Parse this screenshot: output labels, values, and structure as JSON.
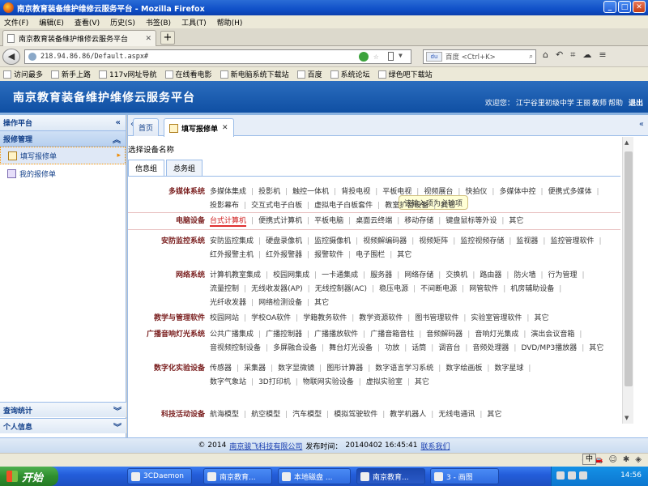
{
  "window": {
    "title": "南京教育装备维护维修云服务平台 - Mozilla Firefox"
  },
  "menu": [
    "文件(F)",
    "编辑(E)",
    "查看(V)",
    "历史(S)",
    "书签(B)",
    "工具(T)",
    "帮助(H)"
  ],
  "browser_tab": {
    "title": "南京教育装备维护维修云服务平台",
    "new_tab": "+"
  },
  "address": {
    "url": "218.94.86.86/Default.aspx#"
  },
  "search": {
    "engine": "百度",
    "placeholder": "百度 <Ctrl+K>"
  },
  "bookmarks": [
    "访问最多",
    "新手上路",
    "117v网址导航",
    "在线看电影",
    "新电脑系统下载站",
    "百度",
    "系统论坛",
    "绿色吧下载站"
  ],
  "app": {
    "title": "南京教育装备维护维修云服务平台",
    "welcome": "欢迎您：",
    "school": "江宁谷里初级中学",
    "user": "王丽",
    "role": "教师",
    "help": "帮助",
    "logout": "退出"
  },
  "sidebar": {
    "header": "操作平台",
    "section": "报修管理",
    "items": [
      {
        "label": "填写报修单"
      },
      {
        "label": "我的报修单"
      }
    ],
    "bottom": [
      "查询统计",
      "个人信息"
    ]
  },
  "main_tabs": [
    {
      "label": "首页"
    },
    {
      "label": "填写报修单"
    }
  ],
  "panel": {
    "title": "选择设备名称",
    "sub_tabs": [
      "信息组",
      "总务组"
    ],
    "tooltip": "该输入项为必输项",
    "selected_item": "台式计算机"
  },
  "categories": [
    {
      "name": "多媒体系统",
      "items": [
        "多媒体集成",
        "投影机",
        "触控一体机",
        "背投电视",
        "平板电视",
        "视频展台",
        "快拍仪",
        "多媒体中控",
        "便携式多媒体",
        "投影幕布",
        "交互式电子白板",
        "虚拟电子白板套件",
        "教室扩音设备",
        "其它"
      ]
    },
    {
      "name": "电脑设备",
      "items": [
        "台式计算机",
        "便携式计算机",
        "平板电脑",
        "桌面云终端",
        "移动存储",
        "键盘鼠标等外设",
        "其它"
      ]
    },
    {
      "name": "安防监控系统",
      "items": [
        "安防监控集成",
        "硬盘录像机",
        "监控摄像机",
        "视频解编码器",
        "视频矩阵",
        "监控视频存储",
        "监视器",
        "监控管理软件",
        "红外报警主机",
        "红外报警器",
        "报警软件",
        "电子围栏",
        "其它"
      ]
    },
    {
      "name": "网络系统",
      "items": [
        "计算机教室集成",
        "校园网集成",
        "一卡通集成",
        "服务器",
        "网络存储",
        "交换机",
        "路由器",
        "防火墙",
        "行为管理",
        "流量控制",
        "无线收发器(AP)",
        "无线控制器(AC)",
        "稳压电源",
        "不间断电源",
        "网管软件",
        "机房辅助设备",
        "光纤收发器",
        "网络检测设备",
        "其它"
      ]
    },
    {
      "name": "教学与管理软件",
      "items": [
        "校园网站",
        "学校OA软件",
        "学籍教务软件",
        "教学资源软件",
        "图书管理软件",
        "实验室管理软件",
        "其它"
      ]
    },
    {
      "name": "广播音响灯光系统",
      "items": [
        "公共广播集成",
        "广播控制器",
        "广播播放软件",
        "广播音箱音柱",
        "音频解码器",
        "音响灯光集成",
        "演出会议音箱",
        "音视频控制设备",
        "多屏融合设备",
        "舞台灯光设备",
        "功放",
        "话筒",
        "调音台",
        "音频处理器",
        "DVD/MP3播放器",
        "其它"
      ]
    },
    {
      "name": "数字化实验设备",
      "items": [
        "传感器",
        "采集器",
        "数字显微镜",
        "图形计算器",
        "数字语言学习系统",
        "数字绘画板",
        "数字星球",
        "数字气象站",
        "3D打印机",
        "物联网实验设备",
        "虚拟实验室",
        "其它"
      ]
    },
    {
      "name": "科技活动设备",
      "items": [
        "航海模型",
        "航空模型",
        "汽车模型",
        "模拟驾驶软件",
        "教学机器人",
        "无线电通讯",
        "其它"
      ]
    }
  ],
  "footer": {
    "copyright": "© 2014",
    "company": "南京骏飞科技有限公司",
    "publish_label": "发布时间：",
    "publish_time": "20140402 16:45:41",
    "contact": "联系我们"
  },
  "taskbar": {
    "start": "开始",
    "tasks": [
      "3CDaemon",
      "南京教育...",
      "本地磁盘 ...",
      "南京教育...",
      "3 - 画图"
    ],
    "ime": "中",
    "clock": "14:56"
  },
  "colors": {
    "app_header": "#1b5cb0",
    "category_text": "#7a1f1f",
    "selected_item": "#d02020",
    "panel_border": "#99bbe8"
  }
}
